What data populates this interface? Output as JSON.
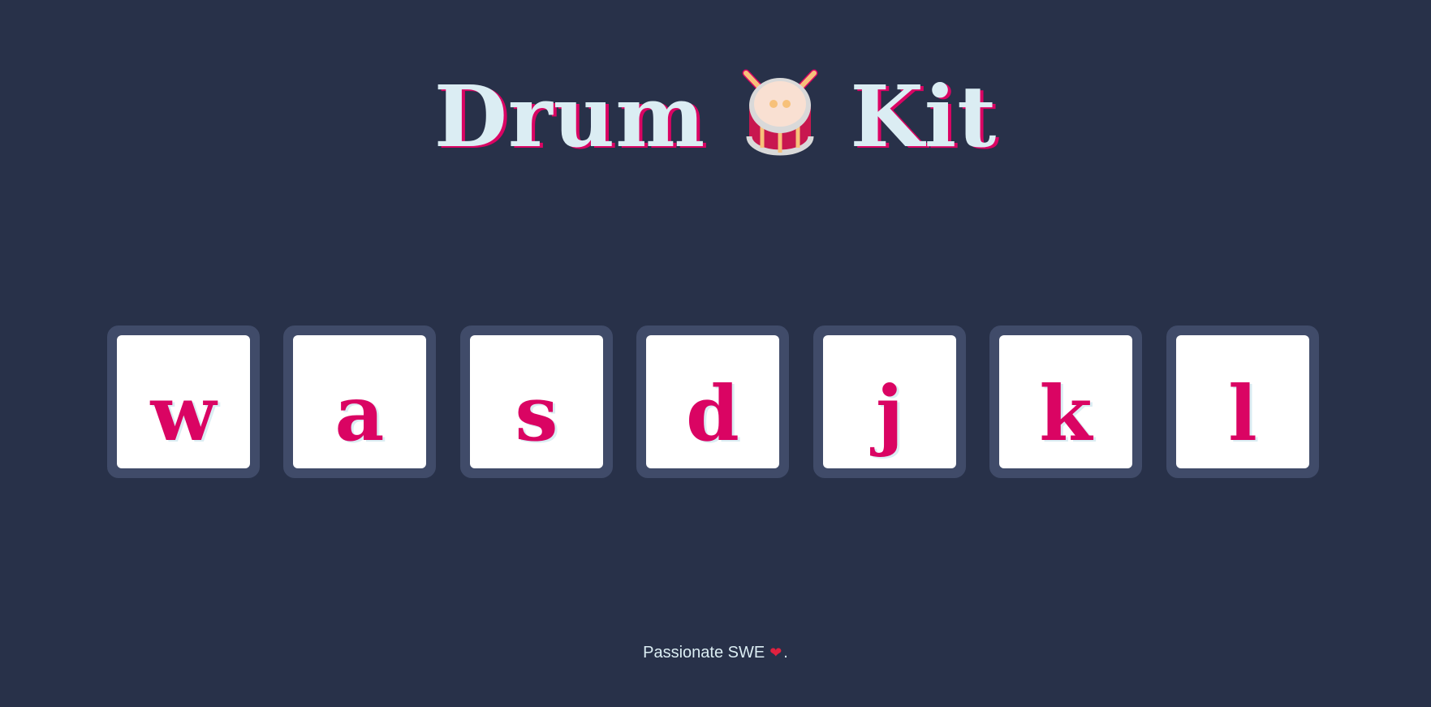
{
  "header": {
    "title_left": "Drum",
    "title_right": "Kit",
    "icon": "drum-icon"
  },
  "keys": [
    {
      "label": "w"
    },
    {
      "label": "a"
    },
    {
      "label": "s"
    },
    {
      "label": "d"
    },
    {
      "label": "j"
    },
    {
      "label": "k"
    },
    {
      "label": "l"
    }
  ],
  "footer": {
    "text": "Passionate SWE",
    "icon": "heart-icon",
    "suffix": "."
  },
  "colors": {
    "background": "#283149",
    "key_frame": "#404B69",
    "accent": "#DA0463",
    "light": "#DBEDF3"
  }
}
